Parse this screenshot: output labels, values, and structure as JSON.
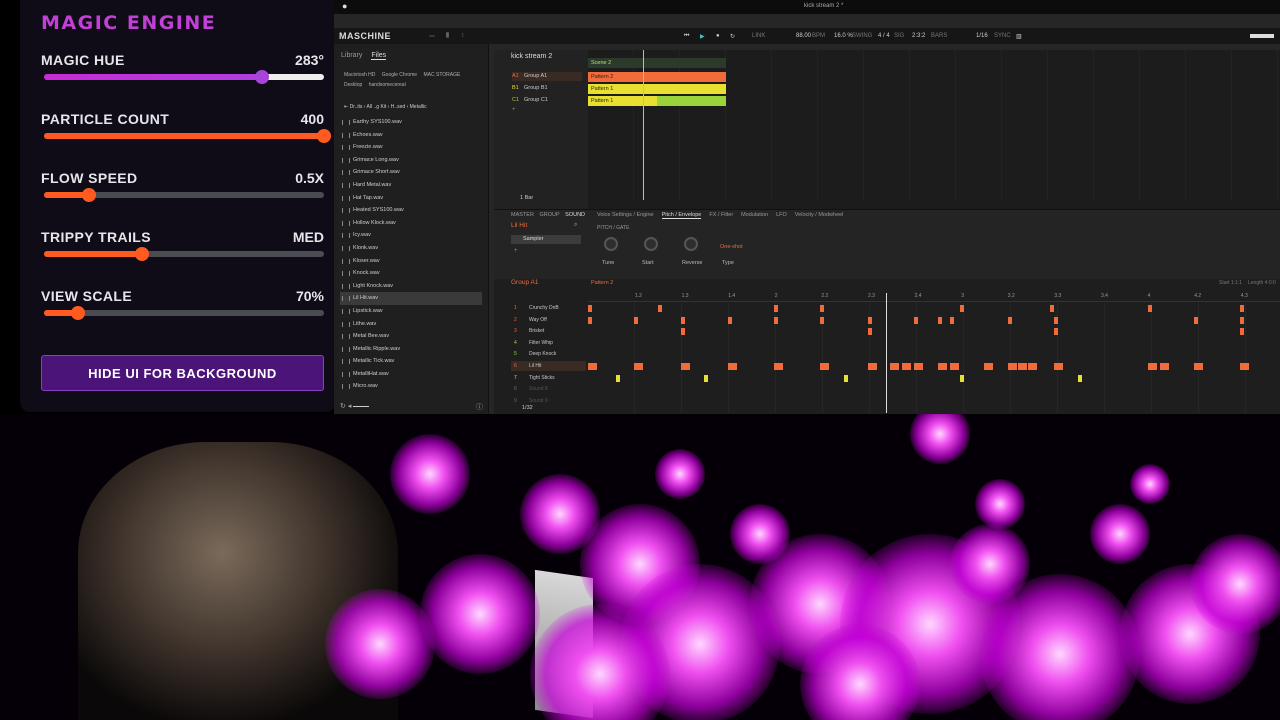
{
  "panel": {
    "title": "MAGIC ENGINE",
    "controls": [
      {
        "label": "MAGIC HUE",
        "value": "283°",
        "level": 0.78,
        "style": "hue"
      },
      {
        "label": "PARTICLE COUNT",
        "value": "400",
        "level": 1.0,
        "style": "orange"
      },
      {
        "label": "FLOW SPEED",
        "value": "0.5X",
        "level": 0.16,
        "style": "orange"
      },
      {
        "label": "TRIPPY TRAILS",
        "value": "MED",
        "level": 0.35,
        "style": "orange"
      },
      {
        "label": "VIEW SCALE",
        "value": "70%",
        "level": 0.12,
        "style": "orange"
      }
    ],
    "hide_button": "HIDE UI FOR BACKGROUND",
    "colors": {
      "title": "#c23fd8",
      "slider": "#ff5a1f",
      "button": "#4a1478"
    }
  },
  "maschine": {
    "logo": "MASCHINE",
    "document": "kick stream 2 *",
    "transport": {
      "tempo": "88.00",
      "tempo_unit": "BPM",
      "swing": "16.0 %",
      "swing_label": "SWING",
      "signature": "4 / 4",
      "sig_label": "SIG",
      "position": "2:3:2",
      "position_label": "BARS",
      "grid": "1/16",
      "sync": "SYNC",
      "link": "LINK"
    },
    "browser": {
      "tabs": [
        "Library",
        "Files"
      ],
      "locations": [
        "Macintosh HD",
        "Google Chrome",
        "MAC STORAGE",
        "Desktop",
        "handsomecereal"
      ],
      "path": [
        "Dr..its",
        "All ..g Kit",
        "H..sed",
        "Metallic"
      ],
      "files": [
        "Earthy SYS100.wav",
        "Echoes.wav",
        "Freezie.wav",
        "Grimace Long.wav",
        "Grimace Short.wav",
        "Hard Metal.wav",
        "Hat Tap.wav",
        "Heated SYS100.wav",
        "Hollow Klock.wav",
        "Icy.wav",
        "Klonk.wav",
        "Kloser.wav",
        "Knock.wav",
        "Light Knock.wav",
        "Lil Hit.wav",
        "Lipstick.wav",
        "Lithe.wav",
        "Metal Bee.wav",
        "Metallic Ripple.wav",
        "Metallic Tick.wav",
        "MetalliHat.wav",
        "Micro.wav"
      ],
      "selected_file": "Lil Hit.wav"
    },
    "arranger": {
      "project": "kick stream 2",
      "scene": "Scene 2",
      "groups": [
        {
          "id": "A1",
          "name": "Group A1",
          "pattern": "Pattern 2",
          "color": "#f26b3a"
        },
        {
          "id": "B1",
          "name": "Group B1",
          "pattern": "Pattern 1",
          "color": "#e8e030"
        },
        {
          "id": "C1",
          "name": "Group C1",
          "pattern": "Pattern 1",
          "color": "#9ad43a"
        }
      ],
      "length": "1 Bar"
    },
    "sound": {
      "tabs": [
        "MASTER",
        "GROUP",
        "SOUND"
      ],
      "name": "Lil Hit",
      "plugin": "Sampler",
      "param_tabs": [
        "Voice Settings / Engine",
        "Pitch / Envelope",
        "FX / Filter",
        "Modulation",
        "LFO",
        "Velocity / Modwheel"
      ],
      "section": "PITCH / GATE",
      "knobs": [
        "Tune",
        "Start",
        "Reverse",
        "Type"
      ],
      "type_value": "One-shot"
    },
    "pattern": {
      "group": "Group A1",
      "pattern": "Pattern 2",
      "start": "Start 1:1:1",
      "length": "Length 4:0:0",
      "step": "1/32",
      "ruler": [
        "1.2",
        "1.3",
        "1.4",
        "2",
        "2.2",
        "2.3",
        "2.4",
        "3",
        "3.2",
        "3.3",
        "3.4",
        "4",
        "4.2",
        "4.3"
      ],
      "lanes": [
        {
          "n": "1",
          "name": "Crunchy DnB"
        },
        {
          "n": "2",
          "name": "Way Off"
        },
        {
          "n": "3",
          "name": "Brisket"
        },
        {
          "n": "4",
          "name": "Filter Whip"
        },
        {
          "n": "5",
          "name": "Deep Knock"
        },
        {
          "n": "6",
          "name": "Lil Hit"
        },
        {
          "n": "7",
          "name": "Tight Sticks"
        },
        {
          "n": "8",
          "name": "Sound 8"
        },
        {
          "n": "9",
          "name": "Sound 9"
        }
      ]
    }
  }
}
